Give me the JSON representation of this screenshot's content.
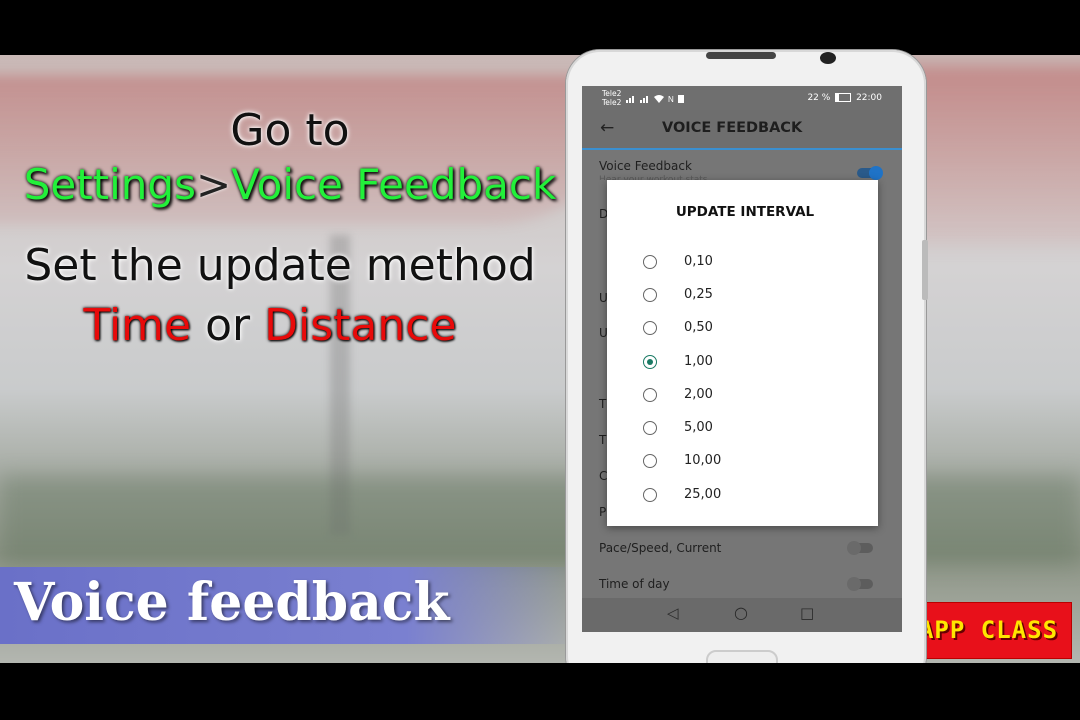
{
  "video": {
    "caption_goto": "Go to",
    "caption_settings": "Settings",
    "caption_separator": ">",
    "caption_voice_feedback": "Voice Feedback",
    "caption_set_method": "Set the update method",
    "caption_time": "Time",
    "caption_or": "or",
    "caption_distance": "Distance",
    "lower_third": "Voice feedback",
    "channel_logo": "APP CLASS",
    "colors": {
      "highlight_green": "#22f03a",
      "highlight_red": "#e80a0a",
      "bar_blue": "#6a70c8",
      "logo_red": "#e8101a",
      "logo_yellow": "#ffe600"
    }
  },
  "phone": {
    "status_bar": {
      "carrier_1": "Tele2",
      "carrier_2": "Tele2",
      "battery": "22 %",
      "time": "22:00"
    },
    "app_bar": {
      "back_icon": "arrow-left-icon",
      "title": "VOICE FEEDBACK",
      "accent": "#3a8fd0"
    },
    "settings": {
      "voice_feedback_label": "Voice Feedback",
      "voice_feedback_sub": "Hear your workout stats",
      "pace_speed_current": "Pace/Speed, Current",
      "time_of_day": "Time of day"
    },
    "dialog": {
      "title": "UPDATE INTERVAL",
      "options": [
        "0,10",
        "0,25",
        "0,50",
        "1,00",
        "2,00",
        "5,00",
        "10,00",
        "25,00"
      ],
      "selected": "1,00",
      "accent": "#1a7a64"
    },
    "nav": {
      "back_icon": "triangle-back-icon",
      "home_icon": "circle-home-icon",
      "recents_icon": "square-recents-icon"
    }
  }
}
